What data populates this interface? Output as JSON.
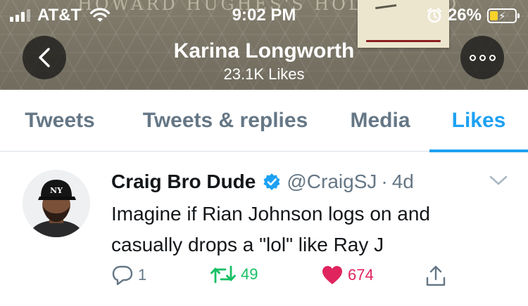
{
  "status_bar": {
    "carrier": "AT&T",
    "time": "9:02 PM",
    "battery_percent": "26%",
    "battery_level": 0.26,
    "icons": [
      "signal-icon",
      "wifi-icon",
      "alarm-icon",
      "battery-charging-icon"
    ]
  },
  "banner": {
    "text": "HOWARD HUGHES'S HOLLYWOOD"
  },
  "profile": {
    "name": "Karina Longworth",
    "likes_count": "23.1K Likes"
  },
  "tabs": [
    {
      "label": "Tweets",
      "active": false
    },
    {
      "label": "Tweets & replies",
      "active": false
    },
    {
      "label": "Media",
      "active": false
    },
    {
      "label": "Likes",
      "active": true
    }
  ],
  "tweet": {
    "author_name": "Craig Bro Dude",
    "verified": true,
    "handle": "@CraigSJ",
    "separator": "·",
    "age": "4d",
    "text": "Imagine if Rian Johnson logs on and casually drops a \"lol\" like Ray J",
    "actions": {
      "reply_count": "1",
      "retweet_count": "49",
      "like_count": "674"
    }
  },
  "colors": {
    "accent": "#1da1f2",
    "secondary_text": "#657786",
    "retweet": "#17bf63",
    "like": "#e0245e"
  }
}
